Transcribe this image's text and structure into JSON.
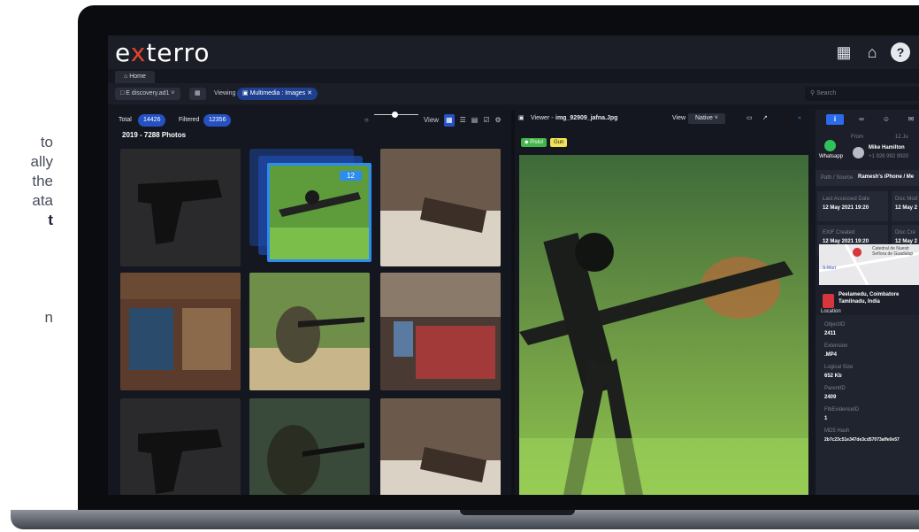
{
  "side_text": {
    "line1": "to",
    "line2": "ally",
    "line3": "the",
    "line4": "ata",
    "line5": "t",
    "line6": "n"
  },
  "app": {
    "logo_prefix": "e",
    "logo_x": "x",
    "logo_suffix": "terro"
  },
  "tab": {
    "home_label": "Home"
  },
  "toolbar": {
    "case_label": "E discovery.ad1",
    "viewing_label": "Viewing",
    "viewing_chip": "Multimedia : Images",
    "search_placeholder": "Search"
  },
  "gallery": {
    "total_label": "Total",
    "total_count": "14426",
    "filtered_label": "Filtered",
    "filtered_count": "12356",
    "view_label": "View",
    "group_title": "2019 - 7288 Photos",
    "stack_count": "12"
  },
  "viewer": {
    "title_prefix": "Viewer -",
    "file_name": "img_92909_jafna.Jpg",
    "view_label": "View",
    "view_mode": "Native",
    "tags": [
      "Pistol",
      "Gun"
    ]
  },
  "details": {
    "from_label": "From",
    "date_short": "12 Ju",
    "app_name": "Whatsapp",
    "sender_name": "Mike Hamilton",
    "sender_phone": "+1 928 992 9920",
    "path_label": "Path / Source",
    "path_value": "Ramesh's iPhone / Me",
    "last_accessed_label": "Last Accessed Date",
    "last_accessed_value": "12 May 2021  19:20",
    "disc_mod_label": "Disc Mod",
    "disc_mod_value": "12 May 2",
    "exif_label": "EXIF Created",
    "exif_value": "12 May 2021  19:20",
    "disc_cre_label": "Disc Cre",
    "disc_cre_value": "12 May 2",
    "location_label": "Location",
    "map_label_1": "Catedral de Nuestr",
    "map_label_2": "Señora de Guadalup",
    "map_label_3": "S-Mart",
    "place_line1": "Peelamedu, Coimbatore",
    "place_line2": "Tamilnadu, India",
    "object_id_label": "ObjectID",
    "object_id_value": "2411",
    "extension_label": "Extension",
    "extension_value": ".MP4",
    "logical_size_label": "Logical Size",
    "logical_size_value": "652 Kb",
    "parent_id_label": "ParentID",
    "parent_id_value": "2409",
    "ftk_label": "FtkEvidenceID",
    "ftk_value": "1",
    "md5_label": "MD5 Hash",
    "md5_value": "2b7c23c51e347de3cd57073affe0e57"
  }
}
